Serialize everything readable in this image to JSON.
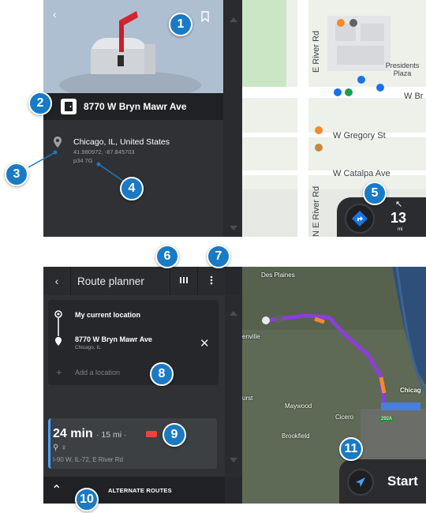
{
  "top": {
    "address": "8770 W Bryn Mawr Ave",
    "location": {
      "city": "Chicago, IL, United States",
      "coords": "41.980972, -87.845703",
      "plus_code": "p34 7G"
    },
    "map": {
      "streets": [
        "E River Rd",
        "W Gregory St",
        "W Catalpa Ave",
        "N E River Rd",
        "W Br"
      ],
      "poi": "Presidents Plaza"
    },
    "nav": {
      "distance": "13",
      "unit": "mi"
    }
  },
  "bottom": {
    "title": "Route planner",
    "stops": [
      {
        "name": "My current location",
        "sub": ""
      },
      {
        "name": "8770 W Bryn Mawr Ave",
        "sub": "Chicago, IL"
      }
    ],
    "add_location": "Add a location",
    "route": {
      "time": "24 min",
      "distance": "· 15 mi ·",
      "roads": "I-90 W, IL-72, E River Rd"
    },
    "alternate_routes": "ALTERNATE ROUTES",
    "start_label": "Start",
    "map_labels": [
      "Des Plaines",
      "enville",
      "Maywood",
      "Cicero",
      "Brookfield",
      "Chicag",
      "292A",
      "urst"
    ]
  },
  "callouts": [
    "1",
    "2",
    "3",
    "4",
    "5",
    "6",
    "7",
    "8",
    "9",
    "10",
    "11"
  ],
  "colors": {
    "callout": "#1a7ac4",
    "route": "#8b3fd9",
    "traffic": "#f28b2c",
    "accent": "#4aa3ff"
  }
}
